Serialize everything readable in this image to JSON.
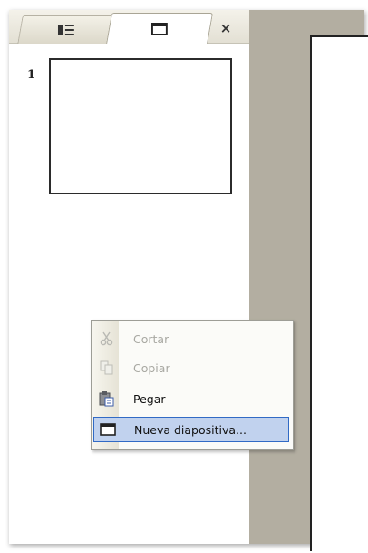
{
  "panel": {
    "tabs": [
      {
        "name": "Esquema",
        "icon": "outline-icon",
        "active": false
      },
      {
        "name": "Diapositivas",
        "icon": "slide-icon",
        "active": true
      }
    ],
    "close_label": "×"
  },
  "thumbnails": [
    {
      "number": "1"
    }
  ],
  "context_menu": {
    "items": [
      {
        "label": "Cortar",
        "icon": "scissors-icon",
        "enabled": false,
        "highlighted": false
      },
      {
        "label": "Copiar",
        "icon": "copy-icon",
        "enabled": false,
        "highlighted": false
      },
      {
        "label": "Pegar",
        "icon": "paste-icon",
        "enabled": true,
        "highlighted": false
      },
      {
        "label": "Nueva diapositiva...",
        "icon": "new-slide-icon",
        "enabled": true,
        "highlighted": true
      }
    ]
  },
  "colors": {
    "editor_background": "#b3aea1",
    "menu_highlight": "#c1d2ee",
    "menu_highlight_border": "#316ac5"
  }
}
